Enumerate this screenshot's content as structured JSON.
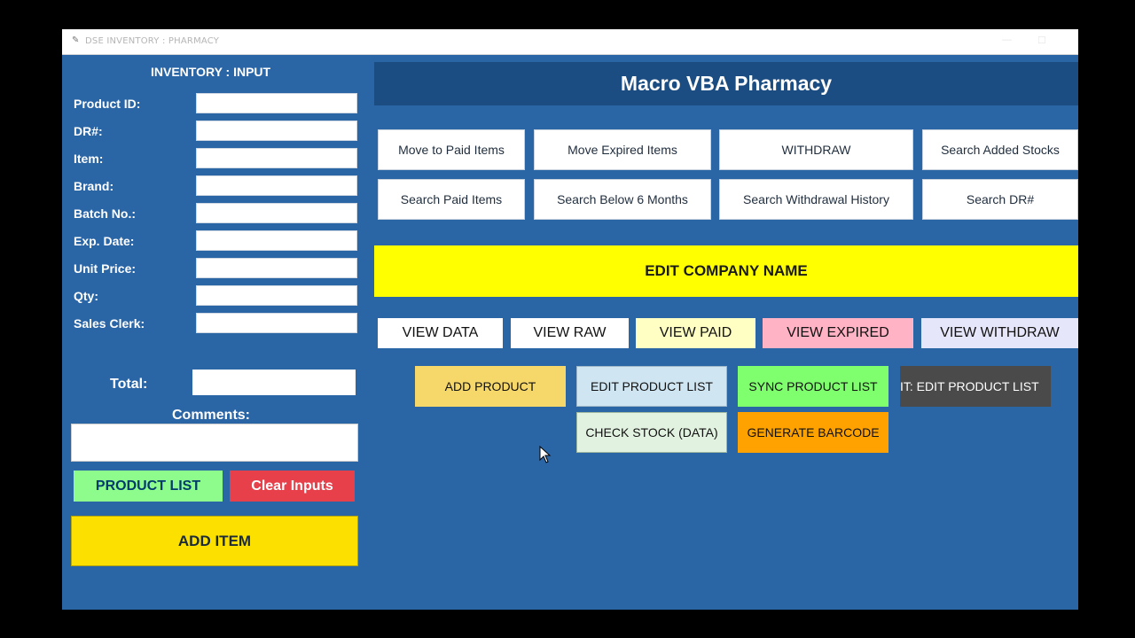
{
  "window": {
    "title": "DSE INVENTORY : PHARMACY"
  },
  "left": {
    "heading": "INVENTORY : INPUT",
    "fields": [
      {
        "label": "Product ID:",
        "value": ""
      },
      {
        "label": "DR#:",
        "value": ""
      },
      {
        "label": "Item:",
        "value": ""
      },
      {
        "label": "Brand:",
        "value": ""
      },
      {
        "label": "Batch No.:",
        "value": ""
      },
      {
        "label": "Exp. Date:",
        "value": ""
      },
      {
        "label": "Unit Price:",
        "value": ""
      },
      {
        "label": "Qty:",
        "value": ""
      },
      {
        "label": "Sales Clerk:",
        "value": ""
      }
    ],
    "total_label": "Total:",
    "comments_label": "Comments:",
    "product_list_button": "PRODUCT LIST",
    "clear_button": "Clear Inputs",
    "add_item_button": "ADD ITEM"
  },
  "header": {
    "title": "Macro VBA Pharmacy"
  },
  "actions_row1": [
    "Move to Paid Items",
    "Move Expired Items",
    "WITHDRAW",
    "Search Added Stocks"
  ],
  "actions_row2": [
    "Search Paid Items",
    "Search Below 6 Months",
    "Search Withdrawal History",
    "Search DR#"
  ],
  "edit_company_button": "EDIT COMPANY NAME",
  "view_buttons": [
    "VIEW DATA",
    "VIEW RAW",
    "VIEW PAID",
    "VIEW EXPIRED",
    "VIEW WITHDRAW"
  ],
  "product_buttons": {
    "add_product": "ADD PRODUCT",
    "edit_product_list": "EDIT PRODUCT LIST",
    "sync_product_list": "SYNC PRODUCT LIST",
    "it_edit_product_list": "IT: EDIT PRODUCT LIST",
    "check_stock": "CHECK STOCK (DATA)",
    "generate_barcode": "GENERATE BARCODE"
  },
  "colors": {
    "background": "#2a65a6",
    "header": "#1c4d82",
    "yellow": "#ffff00",
    "green": "#8efc8c",
    "red": "#e8404b",
    "view_paid": "#ffffc4",
    "view_expired": "#ffb3c4",
    "view_withdraw": "#e6e6fa",
    "add_product": "#f6d76a",
    "edit_product_list": "#cfe6f2",
    "sync_product_list": "#7fff6e",
    "it_edit_product_list": "#4a4a4a",
    "check_stock": "#e2f2e0",
    "generate_barcode": "#ffa200"
  }
}
